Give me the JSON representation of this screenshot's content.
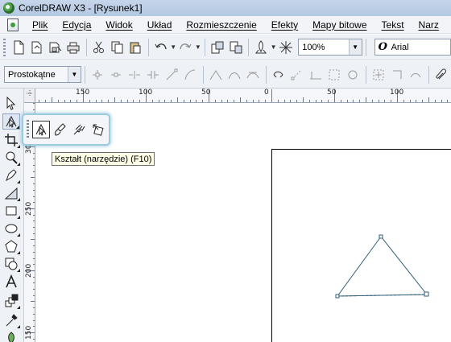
{
  "window": {
    "title": "CorelDRAW X3 - [Rysunek1]"
  },
  "menu": {
    "items": [
      "Plik",
      "Edycja",
      "Widok",
      "Układ",
      "Rozmieszczenie",
      "Efekty",
      "Mapy bitowe",
      "Tekst",
      "Narz"
    ]
  },
  "standard_toolbar": {
    "zoom_value": "100%",
    "font_name": "Arial",
    "font_icon": "O"
  },
  "property_bar": {
    "shape_mode": "Prostokątne"
  },
  "rulers": {
    "top_labels": [
      "150",
      "100",
      "50",
      "0",
      "50",
      "100"
    ],
    "left_labels": [
      "300",
      "250",
      "200",
      "150"
    ]
  },
  "flyout": {
    "tools": [
      "shape-tool-icon",
      "smudge-brush-icon",
      "roughen-brush-icon",
      "free-transform-icon"
    ]
  },
  "tooltip": {
    "text": "Kształt (narzędzie) (F10)"
  },
  "colors": {
    "accent": "#9ccbe0",
    "triangle_stroke": "#2f5f7a"
  }
}
